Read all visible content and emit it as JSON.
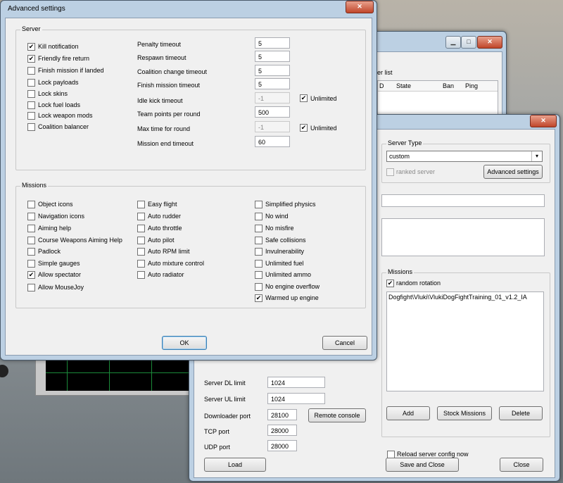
{
  "advanced": {
    "title": "Advanced settings",
    "close_glyph": "✕",
    "server_group": "Server",
    "missions_group": "Missions",
    "server_checks": [
      {
        "label": "Kill notification",
        "checked": true
      },
      {
        "label": "Friendly fire return",
        "checked": true
      },
      {
        "label": "Finish mission if landed",
        "checked": false
      },
      {
        "label": "Lock payloads",
        "checked": false
      },
      {
        "label": "Lock skins",
        "checked": false
      },
      {
        "label": "Lock fuel loads",
        "checked": false
      },
      {
        "label": "Lock weapon mods",
        "checked": false
      },
      {
        "label": "Coalition balancer",
        "checked": false
      }
    ],
    "server_fields": [
      {
        "label": "Penalty timeout",
        "value": "5",
        "disabled": false
      },
      {
        "label": "Respawn timeout",
        "value": "5",
        "disabled": false
      },
      {
        "label": "Coalition change timeout",
        "value": "5",
        "disabled": false
      },
      {
        "label": "Finish mission timeout",
        "value": "5",
        "disabled": false
      },
      {
        "label": "Idle kick timeout",
        "value": "-1",
        "disabled": true,
        "unlimited": true
      },
      {
        "label": "Team points per round",
        "value": "500",
        "disabled": false
      },
      {
        "label": "Max time for round",
        "value": "-1",
        "disabled": true,
        "unlimited": true
      },
      {
        "label": "Mission end timeout",
        "value": "60",
        "disabled": false
      }
    ],
    "unlimited_label": "Unlimited",
    "missions_col1": [
      {
        "label": "Object icons",
        "checked": false
      },
      {
        "label": "Navigation icons",
        "checked": false
      },
      {
        "label": "Aiming help",
        "checked": false
      },
      {
        "label": "Course Weapons Aiming Help",
        "checked": false
      },
      {
        "label": "Padlock",
        "checked": false
      },
      {
        "label": "Simple gauges",
        "checked": false
      },
      {
        "label": "Allow spectator",
        "checked": true
      },
      {
        "label": "Allow MouseJoy",
        "checked": false
      }
    ],
    "missions_col2": [
      {
        "label": "Easy flight",
        "checked": false
      },
      {
        "label": "Auto rudder",
        "checked": false
      },
      {
        "label": "Auto throttle",
        "checked": false
      },
      {
        "label": "Auto pilot",
        "checked": false
      },
      {
        "label": "Auto RPM limit",
        "checked": false
      },
      {
        "label": "Auto mixture control",
        "checked": false
      },
      {
        "label": "Auto radiator",
        "checked": false
      }
    ],
    "missions_col3": [
      {
        "label": "Simplified physics",
        "checked": false
      },
      {
        "label": "No wind",
        "checked": false
      },
      {
        "label": "No misfire",
        "checked": false
      },
      {
        "label": "Safe collisions",
        "checked": false
      },
      {
        "label": "Invulnerability",
        "checked": false
      },
      {
        "label": "Unlimited fuel",
        "checked": false
      },
      {
        "label": "Unlimited ammo",
        "checked": false
      },
      {
        "label": "No engine overflow",
        "checked": false
      },
      {
        "label": "Warmed up engine",
        "checked": true
      }
    ],
    "ok_label": "OK",
    "cancel_label": "Cancel"
  },
  "server_list_window": {
    "title_fragment": "er list",
    "columns": [
      "D",
      "State",
      "Ban",
      "Ping"
    ],
    "min_glyph": "▁",
    "max_glyph": "□",
    "close_glyph": "✕"
  },
  "server_settings": {
    "close_glyph": "✕",
    "server_type_group": "Server Type",
    "server_type_value": "custom",
    "ranked_label": "ranked server",
    "advanced_button": "Advanced settings",
    "missions_group": "Missions",
    "random_rotation_label": "random rotation",
    "mission_item": "Dogfight\\Vluki\\VlukiDogFightTraining_01_v1.2_IA",
    "add_button": "Add",
    "stock_button": "Stock Missions",
    "delete_button": "Delete",
    "reload_label": "Reload server config now",
    "fields": [
      {
        "label": "Server DL limit",
        "value": "1024"
      },
      {
        "label": "Server UL limit",
        "value": "1024"
      },
      {
        "label": "Downloader port",
        "value": "28100"
      },
      {
        "label": "TCP port",
        "value": "28000"
      },
      {
        "label": "UDP port",
        "value": "28000"
      }
    ],
    "remote_console_button": "Remote console",
    "load_button": "Load",
    "save_close_button": "Save and Close",
    "close_button": "Close"
  }
}
